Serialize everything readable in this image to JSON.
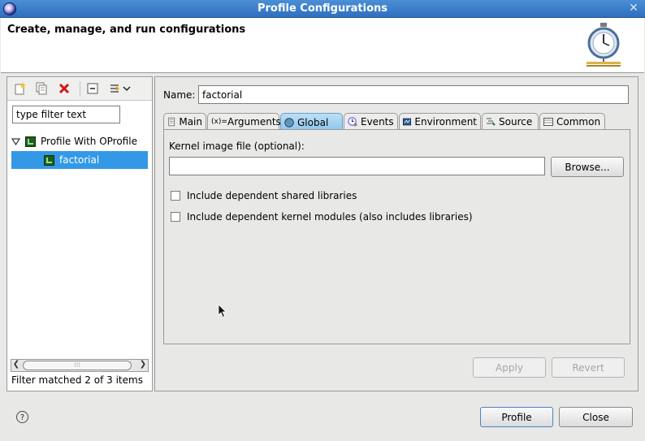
{
  "window": {
    "title": "Profile Configurations"
  },
  "header": {
    "message": "Create, manage, and run configurations"
  },
  "left_panel": {
    "toolbar": [
      {
        "name": "new-configuration-icon"
      },
      {
        "name": "duplicate-icon"
      },
      {
        "name": "delete-icon"
      },
      {
        "name": "collapse-all-icon"
      },
      {
        "name": "filter-menu-icon"
      }
    ],
    "filter_placeholder": "type filter text",
    "tree": {
      "parent": "Profile With OProfile",
      "child": "factorial"
    },
    "filter_status": "Filter matched 2 of 3 items"
  },
  "right_panel": {
    "name_label": "Name:",
    "name_value": "factorial",
    "tabs": [
      {
        "label": "Main",
        "icon": "document-icon"
      },
      {
        "label": "Arguments",
        "icon": "variable-icon"
      },
      {
        "label": "Global",
        "icon": "globe-icon",
        "active": true
      },
      {
        "label": "Events",
        "icon": "clock-gear-icon"
      },
      {
        "label": "Environment",
        "icon": "environment-icon"
      },
      {
        "label": "Source",
        "icon": "source-icon"
      },
      {
        "label": "Common",
        "icon": "common-icon"
      }
    ],
    "global_tab": {
      "kernel_label": "Kernel image file (optional):",
      "kernel_value": "",
      "browse_label": "Browse...",
      "include_shared": {
        "label": "Include dependent shared libraries",
        "checked": false
      },
      "include_kernel": {
        "label": "Include dependent kernel modules (also includes libraries)",
        "checked": false
      }
    },
    "apply_label": "Apply",
    "revert_label": "Revert"
  },
  "footer": {
    "profile_label": "Profile",
    "close_label": "Close"
  },
  "colors": {
    "titlebar": "#3d7fcc",
    "selection": "#3399e6",
    "active_tab": "#9dcff0"
  }
}
